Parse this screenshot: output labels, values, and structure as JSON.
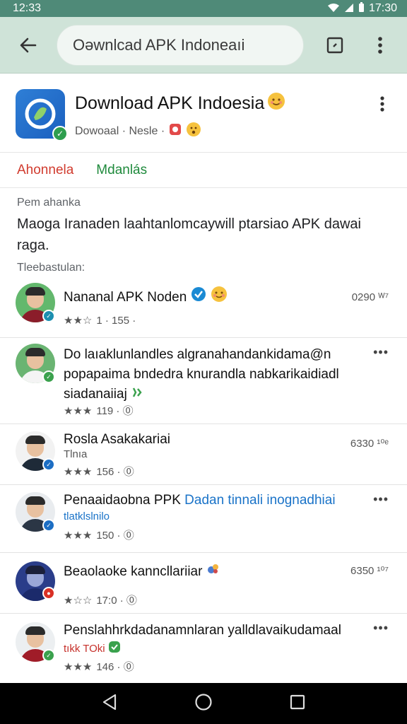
{
  "status_bar": {
    "time_left": "12:33",
    "time_right": "17:30"
  },
  "app_bar": {
    "search_text": "Oǝwnlcad APK Indoneaıi"
  },
  "header": {
    "title": "Download APK Indoesia",
    "subtitle": "Dowoaal · Nesle ·"
  },
  "tabs": [
    {
      "label": "Ahonnela"
    },
    {
      "label": "Mdanlás"
    }
  ],
  "about": {
    "heading": "Pem ahanka",
    "description": "Maoga Iranaden laahtanlomcaywill ptarsiao APK dawai raga."
  },
  "feed_heading": "Tleebastulan:",
  "feed": [
    {
      "title": "Nananal APK Noden",
      "stars": "★★☆",
      "meta": "1 · 155 ·",
      "right": "0290 ᵂ⁷",
      "badge_color": "#1c8fb0",
      "avatar_bg": "#63b86d",
      "shirt": "#8b1d2a",
      "title_lines": 1
    },
    {
      "title": "Do laıaklunlandles algranahandankidama@n popapaima bndedra knurandla nabkarikaidiadl siadanaiiaj",
      "stars": "★★★",
      "meta": "119 · ⓪",
      "right": "",
      "badge_color": "#3aa14d",
      "avatar_bg": "#6ab472",
      "shirt": "#f4f4f4",
      "title_lines": 3
    },
    {
      "title": "Rosla Asakakariai",
      "subtitle": "Tlnıa",
      "stars": "★★★",
      "meta": "156 · ⓪",
      "right": "6330 ¹⁰ᵉ",
      "badge_color": "#1c6ec4",
      "avatar_bg": "#f2f2f2",
      "shirt": "#1e2a38",
      "title_lines": 1
    },
    {
      "title": "Penaaidaobna PPK",
      "title_blue": "Dadan tinnali inognadhiai",
      "subtitle_blue": "tlatklslnilo",
      "stars": "★★★",
      "meta": "150 · ⓪",
      "right": "",
      "badge_color": "#1c6ec4",
      "avatar_bg": "#e9ecef",
      "shirt": "#2b3645",
      "title_lines": 1
    },
    {
      "title": "Beaolaoke kanncllariiar",
      "stars": "★☆☆",
      "meta": "17:0 · ⓪",
      "right": "6350 ¹⁰⁷",
      "badge_color": "#d93025",
      "avatar_bg": "#2a3d8a",
      "shirt": "#1b2a6b",
      "title_lines": 1
    },
    {
      "title": "Penslahhrkdadanamnlaran yalldlavaikudamaal",
      "subtitle_red": "tıkk TOki",
      "stars": "★★★",
      "meta": "146 · ⓪",
      "right": "",
      "badge_color": "#3aa14d",
      "avatar_bg": "#eceff1",
      "shirt": "#a01c28",
      "title_lines": 1
    }
  ],
  "colors": {
    "accent_green": "#1f8a3c",
    "accent_red": "#d13b2e",
    "app_bar": "#cfe3d8",
    "status_bar": "#4f8a78"
  }
}
